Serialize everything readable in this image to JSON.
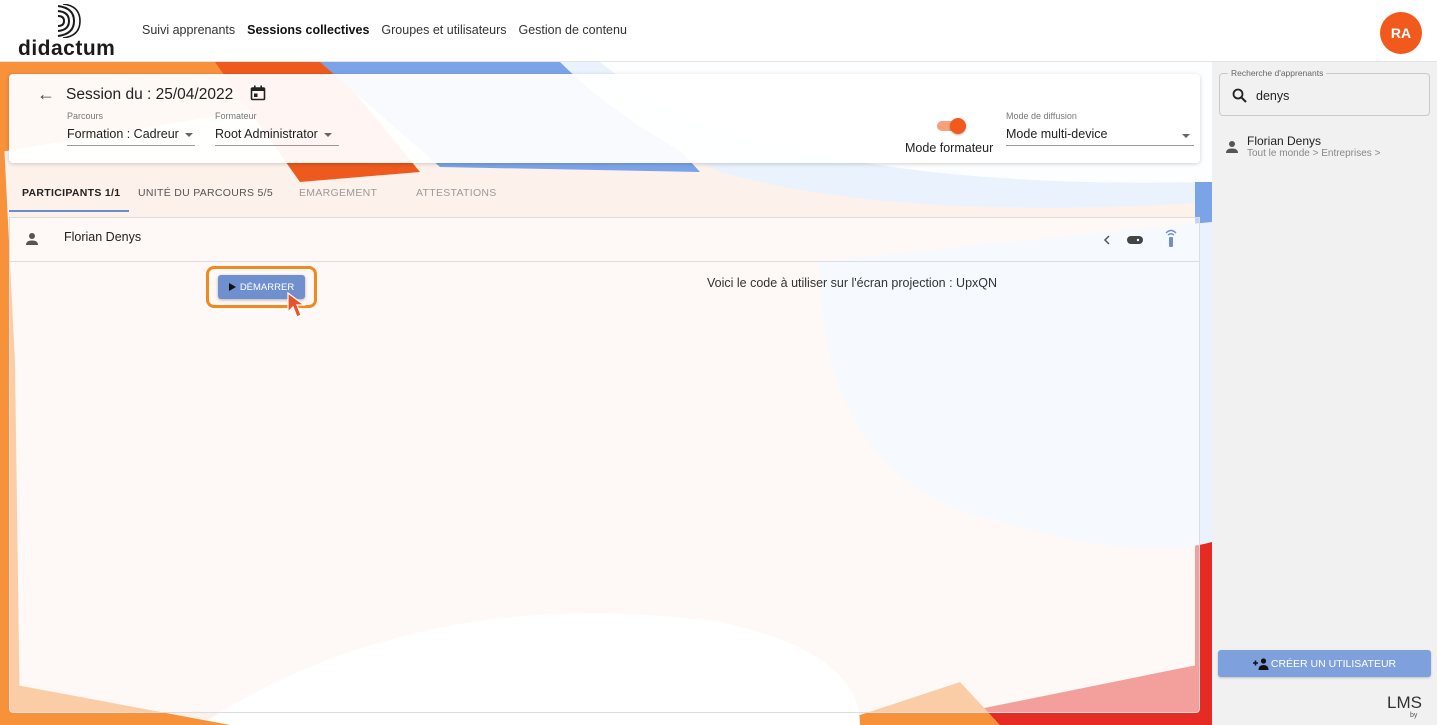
{
  "brand": {
    "name": "didactum"
  },
  "nav": {
    "items": [
      {
        "label": "Suivi apprenants",
        "active": false
      },
      {
        "label": "Sessions collectives",
        "active": true
      },
      {
        "label": "Groupes et utilisateurs",
        "active": false
      },
      {
        "label": "Gestion de contenu",
        "active": false
      }
    ]
  },
  "user": {
    "initials": "RA",
    "color": "#f25a1d"
  },
  "session": {
    "title": "Session du : 25/04/2022",
    "parcours_label": "Parcours",
    "parcours_value": "Formation : Cadreur",
    "formateur_label": "Formateur",
    "formateur_value": "Root Administrator",
    "mode_formateur_label": "Mode formateur",
    "mode_formateur_on": true,
    "diffusion_label": "Mode de diffusion",
    "diffusion_value": "Mode multi-device"
  },
  "tabs": [
    {
      "label": "PARTICIPANTS 1/1",
      "active": true
    },
    {
      "label": "UNITÉ DU PARCOURS 5/5",
      "active": false
    },
    {
      "label": "EMARGEMENT",
      "active": false
    },
    {
      "label": "ATTESTATIONS",
      "active": false
    }
  ],
  "participants": [
    {
      "name": "Florian Denys"
    }
  ],
  "actions": {
    "start_label": "DÉMARRER",
    "projection_text": "Voici le code à utiliser sur l'écran projection : UpxQN"
  },
  "sidebar": {
    "search_label": "Recherche d'apprenants",
    "search_value": "denys",
    "results": [
      {
        "name": "Florian Denys",
        "path": "Tout le monde > Entreprises >"
      }
    ],
    "create_label": "CRÉER UN UTILISATEUR",
    "footer_logo": "LMS",
    "footer_sub": "by"
  },
  "colors": {
    "accent": "#f25a1d",
    "button_blue": "#6f8fcf",
    "highlight": "#f08a1e"
  }
}
